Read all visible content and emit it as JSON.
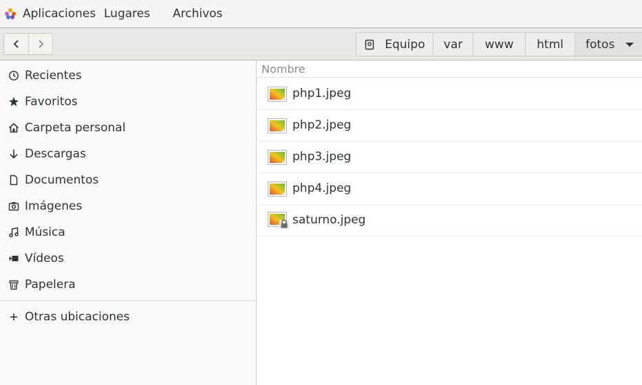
{
  "topbar": {
    "menus": [
      "Aplicaciones",
      "Lugares",
      "Archivos"
    ]
  },
  "pathbar": {
    "crumbs": [
      "Equipo",
      "var",
      "www",
      "html",
      "fotos"
    ]
  },
  "sidebar": {
    "items": [
      {
        "label": "Recientes",
        "icon": "clock-icon"
      },
      {
        "label": "Favoritos",
        "icon": "star-icon"
      },
      {
        "label": "Carpeta personal",
        "icon": "home-icon"
      },
      {
        "label": "Descargas",
        "icon": "download-icon"
      },
      {
        "label": "Documentos",
        "icon": "document-icon"
      },
      {
        "label": "Imágenes",
        "icon": "camera-icon"
      },
      {
        "label": "Música",
        "icon": "music-icon"
      },
      {
        "label": "Vídeos",
        "icon": "video-icon"
      },
      {
        "label": "Papelera",
        "icon": "trash-icon"
      }
    ],
    "other": {
      "label": "Otras ubicaciones",
      "icon": "plus-icon"
    }
  },
  "main": {
    "column_header": "Nombre",
    "files": [
      {
        "name": "php1.jpeg",
        "locked": false
      },
      {
        "name": "php2.jpeg",
        "locked": false
      },
      {
        "name": "php3.jpeg",
        "locked": false
      },
      {
        "name": "php4.jpeg",
        "locked": false
      },
      {
        "name": "saturno.jpeg",
        "locked": true
      }
    ]
  },
  "colors": {
    "text": "#2e3436",
    "header_bg": "#e8e8e7",
    "sidebar_bg": "#fafafa"
  }
}
